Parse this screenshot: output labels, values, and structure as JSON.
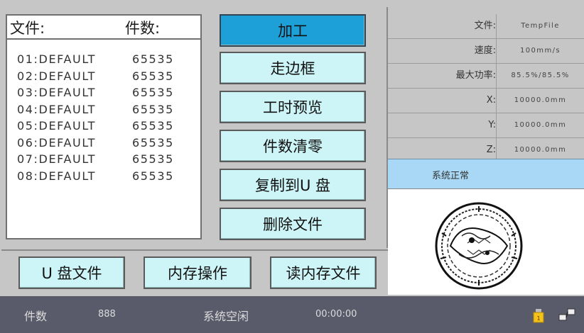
{
  "file_list": {
    "header_file": "文件:",
    "header_count": "件数:",
    "rows": [
      {
        "name": "01:DEFAULT",
        "count": "65535"
      },
      {
        "name": "02:DEFAULT",
        "count": "65535"
      },
      {
        "name": "03:DEFAULT",
        "count": "65535"
      },
      {
        "name": "04:DEFAULT",
        "count": "65535"
      },
      {
        "name": "05:DEFAULT",
        "count": "65535"
      },
      {
        "name": "06:DEFAULT",
        "count": "65535"
      },
      {
        "name": "07:DEFAULT",
        "count": "65535"
      },
      {
        "name": "08:DEFAULT",
        "count": "65535"
      }
    ]
  },
  "actions": {
    "process": "加工",
    "trace_frame": "走边框",
    "time_preview": "工时预览",
    "clear_count": "件数清零",
    "copy_to_u": "复制到U 盘",
    "delete_file": "删除文件"
  },
  "bottom_buttons": {
    "u_disk_files": "U 盘文件",
    "memory_ops": "内存操作",
    "read_memory_file": "读内存文件"
  },
  "info": [
    {
      "label": "文件:",
      "value": "TempFile"
    },
    {
      "label": "速度:",
      "value": "100mm/s"
    },
    {
      "label": "最大功率:",
      "value": "85.5%/85.5%"
    },
    {
      "label": "X:",
      "value": "10000.0mm"
    },
    {
      "label": "Y:",
      "value": "10000.0mm"
    },
    {
      "label": "Z:",
      "value": "10000.0mm"
    }
  ],
  "system_status": "系统正常",
  "status_bar": {
    "count_label": "件数",
    "count_value": "888",
    "system_state": "系统空闲",
    "timer": "00:00:00"
  },
  "icons": {
    "usb_status": "usb-drive-icon",
    "network_status": "network-link-icon"
  },
  "colors": {
    "active_button": "#1da0d8",
    "button": "#cdf5f7",
    "status_strip": "#a8d8f5",
    "status_bar": "#595a6a"
  }
}
